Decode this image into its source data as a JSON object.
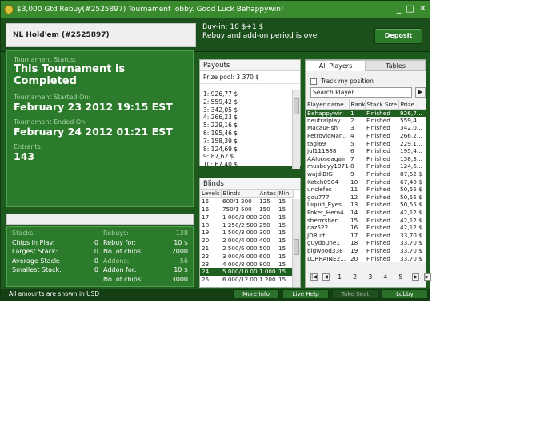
{
  "window": {
    "title": "$3,000 Gtd Rebuy(#2525897) Tournament lobby. Good Luck Behappywin!",
    "controls": [
      "_",
      "□",
      "✕"
    ]
  },
  "header": {
    "game_tab": "NL Hold'em (#2525897)",
    "buyin": "Buy-in: 10 $+1 $",
    "rebuy_note": "Rebuy and add-on period is over",
    "deposit_label": "Deposit"
  },
  "status": {
    "status_label": "Tournament Status:",
    "status_value": "This Tournament is Completed",
    "started_label": "Tournament Started On:",
    "started_value": "February 23 2012  19:15 EST",
    "ended_label": "Tournament Ended On:",
    "ended_value": "February 24 2012  01:21 EST",
    "entrants_label": "Entrants:",
    "entrants_value": "143"
  },
  "stats": {
    "left": [
      {
        "label": "Stacks",
        "value": "",
        "header": true
      },
      {
        "label": "Chips in Play:",
        "value": "0"
      },
      {
        "label": "Largest Stack:",
        "value": "0"
      },
      {
        "label": "Average Stack:",
        "value": "0"
      },
      {
        "label": "Smallest Stack:",
        "value": "0"
      }
    ],
    "right": [
      {
        "label": "Rebuys:",
        "value": "138",
        "header": true
      },
      {
        "label": "Rebuy for:",
        "value": "10 $"
      },
      {
        "label": "No. of chips:",
        "value": "2000"
      },
      {
        "label": "Addons:",
        "value": "56",
        "header": true
      },
      {
        "label": "Addon for:",
        "value": "10 $"
      },
      {
        "label": "No. of chips:",
        "value": "3000"
      }
    ]
  },
  "payouts": {
    "title": "Payouts",
    "prize_pool": "Prize pool: 3 370 $",
    "items": [
      "1: 926,77 $",
      "2: 559,42 $",
      "3: 342,05 $",
      "4: 266,23 $",
      "5: 229,16 $",
      "6: 195,46 $",
      "7: 158,39 $",
      "8: 124,69 $",
      "9: 87,62 $",
      "10: 67,40 $"
    ]
  },
  "blinds": {
    "title": "Blinds",
    "columns": [
      "Levels",
      "Blinds",
      "Antes",
      "Min."
    ],
    "rows": [
      [
        "15",
        "600/1 200",
        "125",
        "15"
      ],
      [
        "16",
        "750/1 500",
        "150",
        "15"
      ],
      [
        "17",
        "1 000/2 000",
        "200",
        "15"
      ],
      [
        "18",
        "1 250/2 500",
        "250",
        "15"
      ],
      [
        "19",
        "1 500/3 000",
        "300",
        "15"
      ],
      [
        "20",
        "2 000/4 000",
        "400",
        "15"
      ],
      [
        "21",
        "2 500/5 000",
        "500",
        "15"
      ],
      [
        "22",
        "3 000/6 000",
        "600",
        "15"
      ],
      [
        "23",
        "4 000/8 000",
        "800",
        "15"
      ],
      [
        "24",
        "5 000/10 000",
        "1 000",
        "15"
      ],
      [
        "25",
        "6 000/12 000",
        "1 200",
        "15"
      ]
    ],
    "active_level": "24"
  },
  "players": {
    "tabs": [
      "All Players",
      "Tables"
    ],
    "track_label": "Track my position",
    "search_placeholder": "Search Player",
    "columns": [
      "Player name",
      "Rank",
      "Stack Size",
      "Prize"
    ],
    "rows": [
      [
        "Behappywin",
        "1",
        "Finished",
        "926,7..."
      ],
      [
        "neutralplay",
        "2",
        "Finished",
        "559,4..."
      ],
      [
        "MacauFish",
        "3",
        "Finished",
        "342,0..."
      ],
      [
        "PetrovicMar...",
        "4",
        "Finished",
        "266,2..."
      ],
      [
        "tagi69",
        "5",
        "Finished",
        "229,1..."
      ],
      [
        "jul111888",
        "6",
        "Finished",
        "195,4..."
      ],
      [
        "AAlooseagain",
        "7",
        "Finished",
        "158,3..."
      ],
      [
        "musboyy1971",
        "8",
        "Finished",
        "124,6..."
      ],
      [
        "wajdiBIG",
        "9",
        "Finished",
        "87,62 $"
      ],
      [
        "Kotch0904",
        "10",
        "Finished",
        "67,40 $"
      ],
      [
        "unclefes",
        "11",
        "Finished",
        "50,55 $"
      ],
      [
        "gou777",
        "12",
        "Finished",
        "50,55 $"
      ],
      [
        "Liquid_Eyes",
        "13",
        "Finished",
        "50,55 $"
      ],
      [
        "Poker_Hero4",
        "14",
        "Finished",
        "42,12 $"
      ],
      [
        "sherrrshen",
        "15",
        "Finished",
        "42,12 $"
      ],
      [
        "caz522",
        "16",
        "Finished",
        "42,12 $"
      ],
      [
        "JDRuff",
        "17",
        "Finished",
        "33,70 $"
      ],
      [
        "guydoune1",
        "18",
        "Finished",
        "33,70 $"
      ],
      [
        "bigwood338",
        "19",
        "Finished",
        "33,70 $"
      ],
      [
        "LORRAINE2...",
        "20",
        "Finished",
        "33,70 $"
      ]
    ],
    "pages": [
      "1",
      "2",
      "3",
      "4",
      "5"
    ]
  },
  "footer": {
    "note": "All amounts are shown in USD",
    "buttons": [
      "More Info",
      "Live Help",
      "Take Seat",
      "Lobby"
    ]
  }
}
